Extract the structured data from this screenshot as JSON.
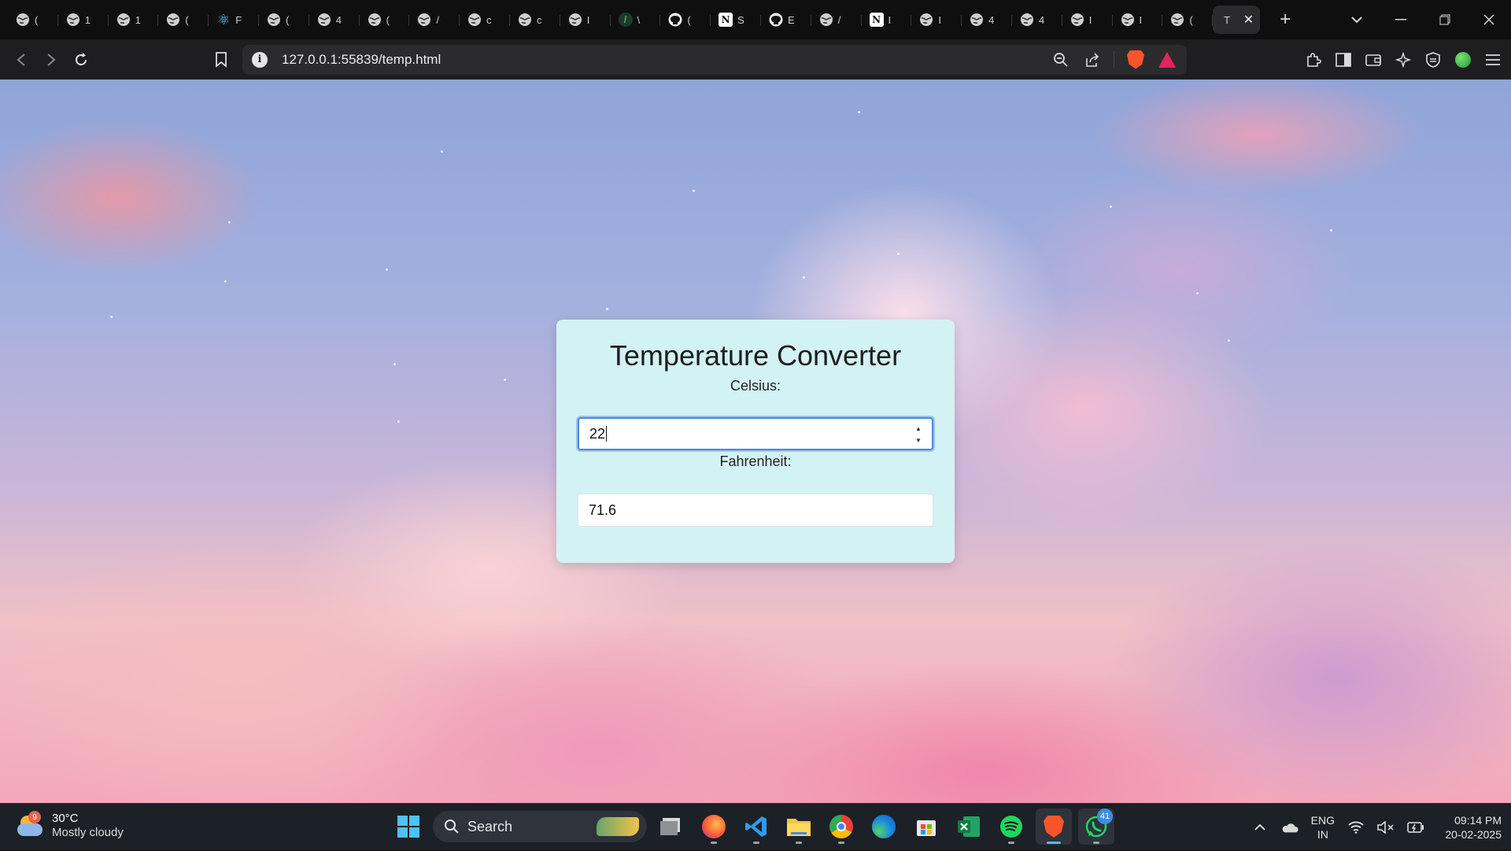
{
  "browser": {
    "tabs": [
      {
        "icon": "globe-icon",
        "text": "("
      },
      {
        "icon": "globe-icon",
        "text": "1"
      },
      {
        "icon": "globe-icon",
        "text": "1"
      },
      {
        "icon": "globe-icon",
        "text": "("
      },
      {
        "icon": "react-icon",
        "text": "F"
      },
      {
        "icon": "globe-icon",
        "text": "("
      },
      {
        "icon": "globe-icon",
        "text": "4"
      },
      {
        "icon": "globe-icon",
        "text": "("
      },
      {
        "icon": "globe-icon",
        "text": "/"
      },
      {
        "icon": "globe-icon",
        "text": "c"
      },
      {
        "icon": "globe-icon",
        "text": "c"
      },
      {
        "icon": "globe-icon",
        "text": "I"
      },
      {
        "icon": "leaf-icon",
        "text": "\\"
      },
      {
        "icon": "github-icon",
        "text": "("
      },
      {
        "icon": "notion-icon",
        "text": "S"
      },
      {
        "icon": "github-icon",
        "text": "E"
      },
      {
        "icon": "globe-icon",
        "text": "/"
      },
      {
        "icon": "notion-icon",
        "text": "I"
      },
      {
        "icon": "globe-icon",
        "text": "I"
      },
      {
        "icon": "globe-icon",
        "text": "4"
      },
      {
        "icon": "globe-icon",
        "text": "4"
      },
      {
        "icon": "globe-icon",
        "text": "I"
      },
      {
        "icon": "globe-icon",
        "text": "I"
      },
      {
        "icon": "globe-icon",
        "text": "("
      }
    ],
    "active_tab": {
      "text": "T"
    },
    "new_tab_symbol": "+",
    "url": "127.0.0.1:55839/temp.html"
  },
  "converter": {
    "title": "Temperature Converter",
    "celsius_label": "Celsius:",
    "celsius_value": "22",
    "fahrenheit_label": "Fahrenheit:",
    "fahrenheit_value": "71.6"
  },
  "taskbar": {
    "weather": {
      "badge": "9",
      "temp": "30°C",
      "condition": "Mostly cloudy"
    },
    "search_label": "Search",
    "whatsapp_badge": "41",
    "lang_top": "ENG",
    "lang_bottom": "IN",
    "time": "09:14 PM",
    "date": "20-02-2025"
  },
  "colors": {
    "card_bg": "#d3f2f3",
    "focus_ring": "#4a89dc",
    "taskbar_bg": "#1c2027",
    "browser_chrome": "#1e1e20"
  }
}
